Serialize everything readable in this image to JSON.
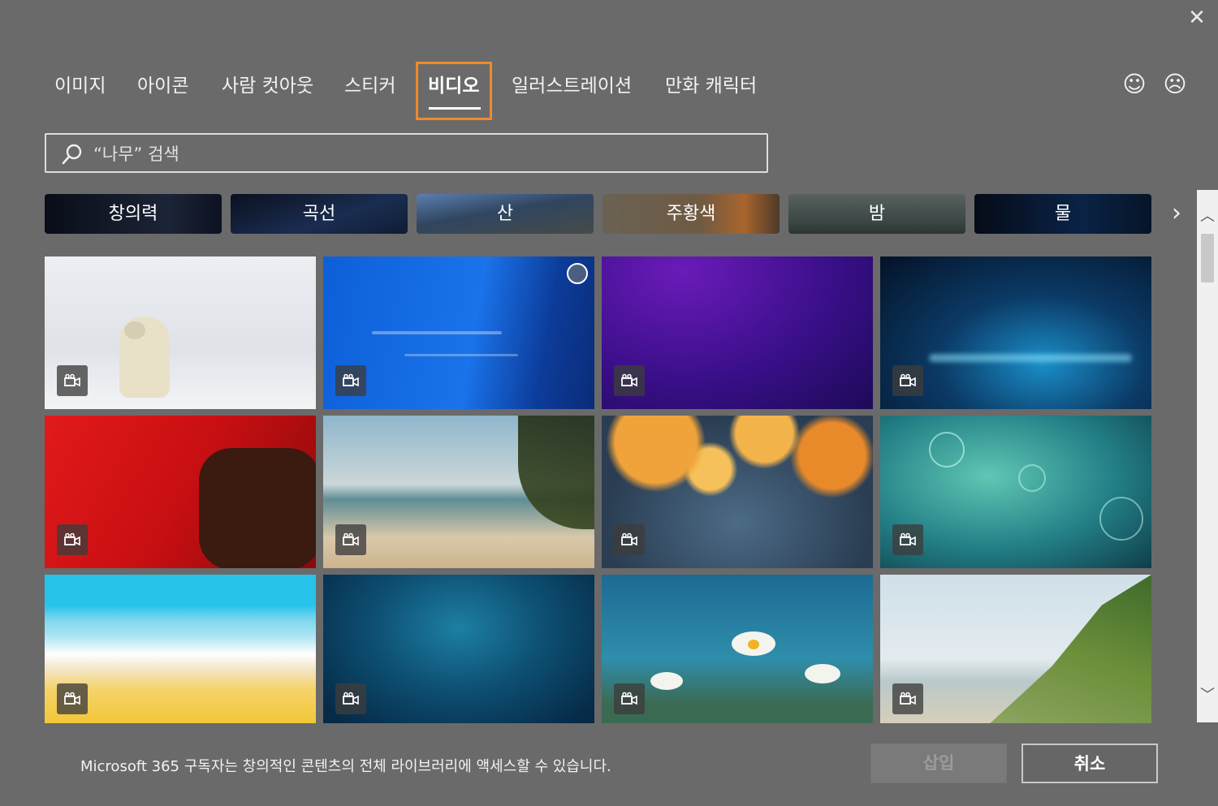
{
  "close_icon": "close-icon",
  "tabs": [
    {
      "label": "이미지"
    },
    {
      "label": "아이콘"
    },
    {
      "label": "사람 컷아웃"
    },
    {
      "label": "스티커"
    },
    {
      "label": "비디오",
      "active": true
    },
    {
      "label": "일러스트레이션"
    },
    {
      "label": "만화 캐릭터"
    }
  ],
  "feedback": {
    "happy_icon": "smile-icon",
    "sad_icon": "frown-icon"
  },
  "search": {
    "placeholder": "“나무” 검색",
    "value": ""
  },
  "categories": [
    {
      "label": "창의력",
      "bg": "#0d1322"
    },
    {
      "label": "곡선",
      "bg": "#14223c"
    },
    {
      "label": "산",
      "bg": "#3b4f6d"
    },
    {
      "label": "주황색",
      "bg": "#6c5a46"
    },
    {
      "label": "밤",
      "bg": "#3a4a50"
    },
    {
      "label": "물",
      "bg": "#08152a"
    }
  ],
  "videos": [
    {
      "name": "polar-bear-video",
      "icon": "video-camera-icon"
    },
    {
      "name": "blue-brush-video",
      "icon": "video-camera-icon"
    },
    {
      "name": "purple-gradient-video",
      "icon": "video-camera-icon"
    },
    {
      "name": "cyan-particles-video",
      "icon": "video-camera-icon"
    },
    {
      "name": "heart-chocolates-video",
      "icon": "video-camera-icon"
    },
    {
      "name": "beach-palm-video",
      "icon": "video-camera-icon"
    },
    {
      "name": "autumn-leaves-video",
      "icon": "video-camera-icon"
    },
    {
      "name": "teal-bubbles-video",
      "icon": "video-camera-icon"
    },
    {
      "name": "paper-waves-video",
      "icon": "video-camera-icon"
    },
    {
      "name": "underwater-video",
      "icon": "video-camera-icon"
    },
    {
      "name": "daisies-video",
      "icon": "video-camera-icon"
    },
    {
      "name": "beach-grass-video",
      "icon": "video-camera-icon"
    }
  ],
  "footer": {
    "message": "Microsoft 365 구독자는 창의적인 콘텐츠의 전체 라이브러리에 액세스할 수 있습니다.",
    "insert_label": "삽입",
    "cancel_label": "취소"
  }
}
